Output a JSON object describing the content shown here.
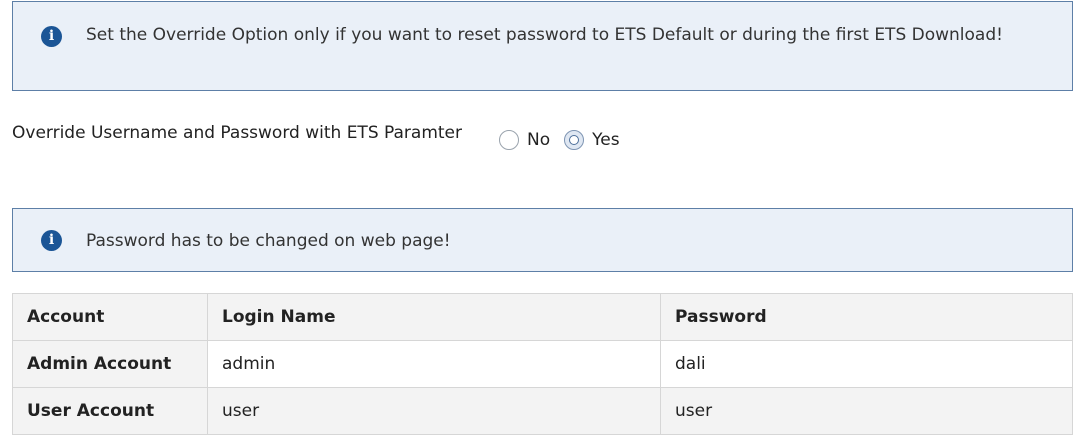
{
  "info_top": {
    "icon": "info-icon",
    "text": "Set the Override Option only if you want to reset password to ETS Default or during the first ETS Download!"
  },
  "override": {
    "label": "Override Username and Password with ETS Paramter",
    "options": [
      {
        "label": "No",
        "checked": false
      },
      {
        "label": "Yes",
        "checked": true
      }
    ]
  },
  "info_mid": {
    "icon": "info-icon",
    "text": "Password has to be changed on web page!"
  },
  "table": {
    "headers": [
      "Account",
      "Login Name",
      "Password"
    ],
    "rows": [
      {
        "account": "Admin Account",
        "login": "admin",
        "password": "dali"
      },
      {
        "account": "User Account",
        "login": "user",
        "password": "user"
      }
    ]
  },
  "colors": {
    "info_bg": "#eaf0f8",
    "info_border": "#5d7fa7",
    "info_icon": "#1b5596"
  }
}
